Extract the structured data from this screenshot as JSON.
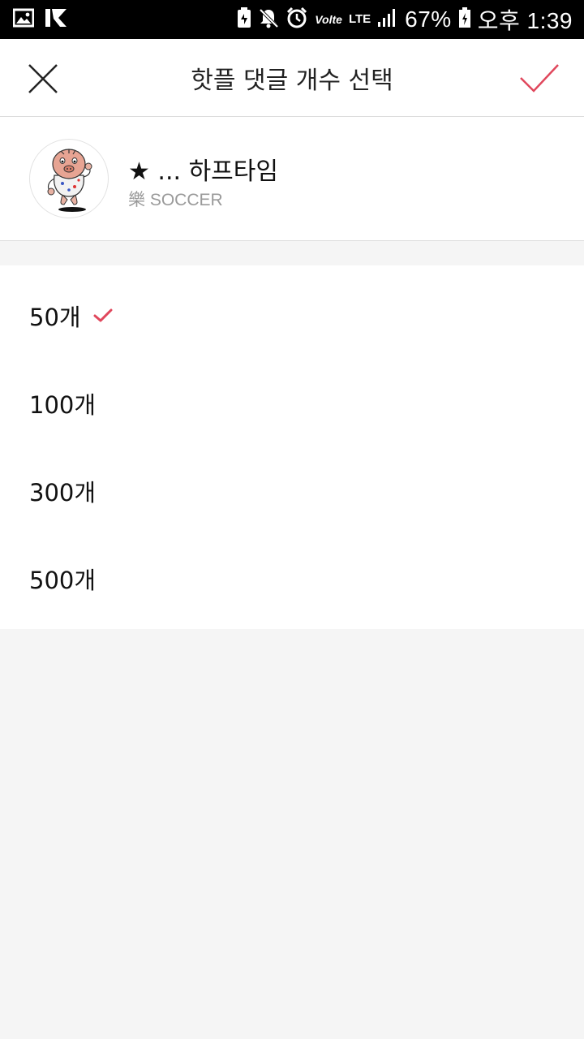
{
  "status_bar": {
    "volte": "Volte",
    "lte": "LTE",
    "battery": "67%",
    "time": "오후 1:39"
  },
  "header": {
    "title": "핫플 댓글 개수 선택",
    "close_icon": "close-icon",
    "confirm_icon": "check-icon",
    "accent_color": "#e0475c"
  },
  "club": {
    "name": "★ ... 하프타임",
    "subtitle": "樂 SOCCER"
  },
  "options": {
    "selected": "50개",
    "items": [
      {
        "label": "50개",
        "selected": true
      },
      {
        "label": "100개",
        "selected": false
      },
      {
        "label": "300개",
        "selected": false
      },
      {
        "label": "500개",
        "selected": false
      }
    ]
  }
}
